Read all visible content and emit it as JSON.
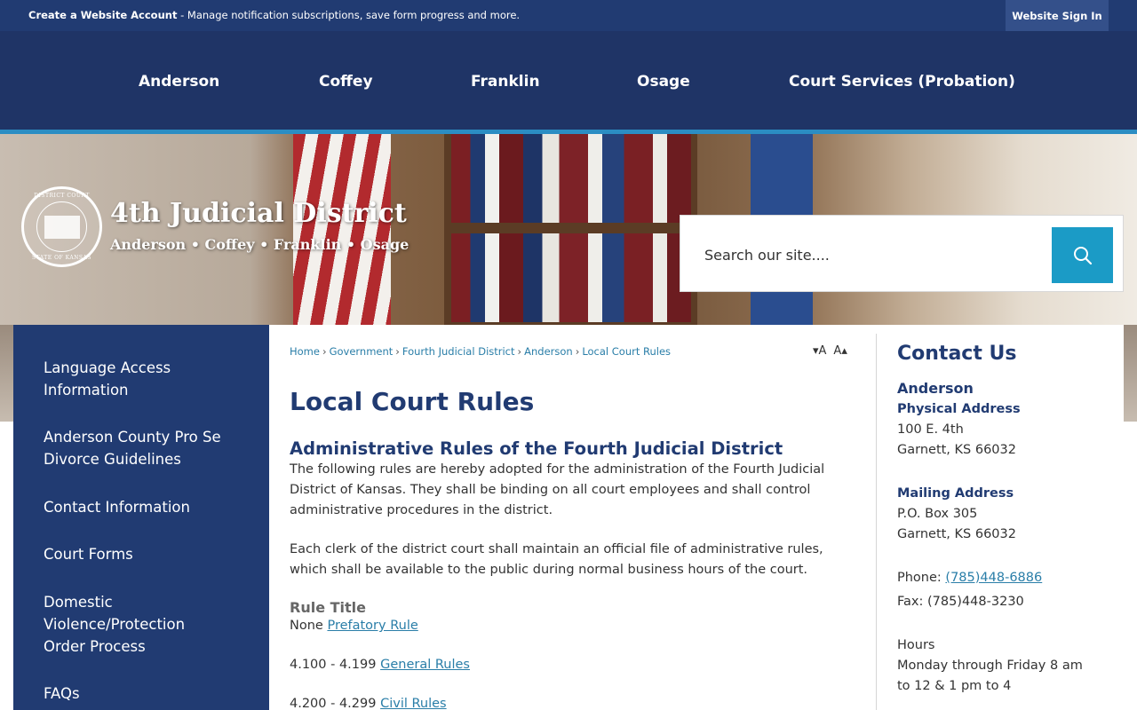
{
  "topbar": {
    "account_bold": "Create a Website Account",
    "account_rest": " - Manage notification subscriptions, save form progress and more.",
    "signin_label": "Website Sign In"
  },
  "nav": {
    "items": [
      {
        "label": "Anderson"
      },
      {
        "label": "Coffey"
      },
      {
        "label": "Franklin"
      },
      {
        "label": "Osage"
      },
      {
        "label": "Court Services (Probation)"
      }
    ]
  },
  "brand": {
    "seal_top": "DISTRICT COURT",
    "seal_bottom": "STATE OF KANSAS",
    "title": "4th Judicial District",
    "subtitle": "Anderson • Coffey • Franklin • Osage"
  },
  "search": {
    "placeholder": "Search our site....",
    "icon": "search-icon"
  },
  "sidebar": {
    "items": [
      {
        "label": "Language Access Information"
      },
      {
        "label": "Anderson County Pro Se Divorce Guidelines"
      },
      {
        "label": "Contact Information"
      },
      {
        "label": "Court Forms"
      },
      {
        "label": "Domestic Violence/Protection Order Process"
      },
      {
        "label": "FAQs"
      }
    ]
  },
  "breadcrumb": {
    "items": [
      "Home",
      "Government",
      "Fourth Judicial District",
      "Anderson",
      "Local Court Rules"
    ]
  },
  "resize": {
    "decrease": "▾A",
    "increase": "A▴"
  },
  "content": {
    "title": "Local Court Rules",
    "section_title": "Administrative Rules of the Fourth Judicial District",
    "para1": "The following rules are hereby adopted for the administration of the Fourth Judicial District of Kansas. They shall be binding on all court employees and shall control administrative procedures in the district.",
    "para2": "Each clerk of the district court shall maintain an official file of administrative rules, which shall be available to the public during normal business hours of the court.",
    "rule_heading": "Rule Title",
    "rules": [
      {
        "number": "None",
        "link": "Prefatory Rule"
      },
      {
        "number": "4.100 - 4.199",
        "link": "General Rules"
      },
      {
        "number": "4.200 - 4.299",
        "link": "Civil Rules"
      }
    ]
  },
  "contact": {
    "title": "Contact Us",
    "county": "Anderson",
    "physical_label": "Physical Address",
    "physical_line1": "100 E. 4th",
    "physical_line2": "Garnett, KS 66032",
    "mailing_label": "Mailing Address",
    "mailing_line1": "P.O. Box 305",
    "mailing_line2": "Garnett, KS 66032",
    "phone_label": "Phone: ",
    "phone_value": "(785)448-6886",
    "fax": "Fax: (785)448-3230",
    "hours_label": "Hours",
    "hours_line1": "Monday through Friday 8 am",
    "hours_line2": "to 12 & 1 pm to 4"
  },
  "colors": {
    "navy": "#213b72",
    "nav_bg": "#1f3466",
    "accent": "#1b9bc6",
    "link": "#2a7ea8"
  }
}
